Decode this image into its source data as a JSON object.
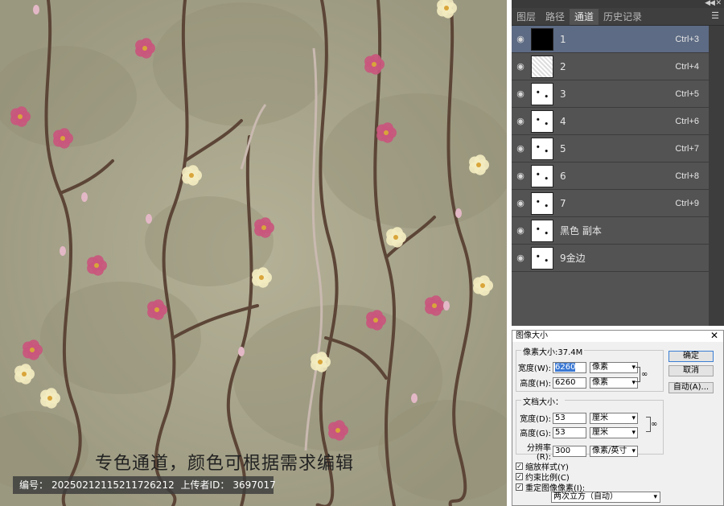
{
  "artwork": {
    "caption": "专色通道，颜色可根据需求编辑",
    "info": {
      "id_label": "编号：",
      "id_value": "20250212115211726212",
      "uploader_label": "上传者ID：",
      "uploader_value": "3697017"
    }
  },
  "channels_panel": {
    "tabs": [
      {
        "label": "图层"
      },
      {
        "label": "路径"
      },
      {
        "label": "通道"
      },
      {
        "label": "历史记录"
      }
    ],
    "active_tab": 2,
    "menu_icon": "panel-menu-icon",
    "rows": [
      {
        "name": "1",
        "shortcut": "Ctrl+3",
        "selected": true
      },
      {
        "name": "2",
        "shortcut": "Ctrl+4",
        "selected": false
      },
      {
        "name": "3",
        "shortcut": "Ctrl+5",
        "selected": false
      },
      {
        "name": "4",
        "shortcut": "Ctrl+6",
        "selected": false
      },
      {
        "name": "5",
        "shortcut": "Ctrl+7",
        "selected": false
      },
      {
        "name": "6",
        "shortcut": "Ctrl+8",
        "selected": false
      },
      {
        "name": "7",
        "shortcut": "Ctrl+9",
        "selected": false
      },
      {
        "name": "黑色 副本",
        "shortcut": "",
        "selected": false
      },
      {
        "name": "9金边",
        "shortcut": "",
        "selected": false
      }
    ]
  },
  "image_size_dialog": {
    "title": "图像大小",
    "close": "✕",
    "pixel_dims_label": "像素大小:37.4M",
    "width_label": "宽度(W):",
    "width_value": "6260",
    "width_unit": "像素",
    "height_label": "高度(H):",
    "height_value": "6260",
    "height_unit": "像素",
    "doc_size_label": "文档大小：",
    "doc_width_label": "宽度(D):",
    "doc_width_value": "53",
    "doc_width_unit": "厘米",
    "doc_height_label": "高度(G):",
    "doc_height_value": "53",
    "doc_height_unit": "厘米",
    "resolution_label": "分辨率(R):",
    "resolution_value": "300",
    "resolution_unit": "像素/英寸",
    "ok_button": "确定",
    "cancel_button": "取消",
    "auto_button": "自动(A)...",
    "scale_styles": "缩放样式(Y)",
    "constrain": "约束比例(C)",
    "resample": "重定图像像素(I):",
    "resample_method": "两次立方（自动）"
  },
  "colors": {
    "background_beige": "#a9a68c",
    "branch_brown": "#5c4536",
    "blossom_pink": "#c9567d",
    "blossom_cream": "#f3ecc0",
    "panel_dark": "#535353",
    "panel_selected": "#5d6b84"
  }
}
